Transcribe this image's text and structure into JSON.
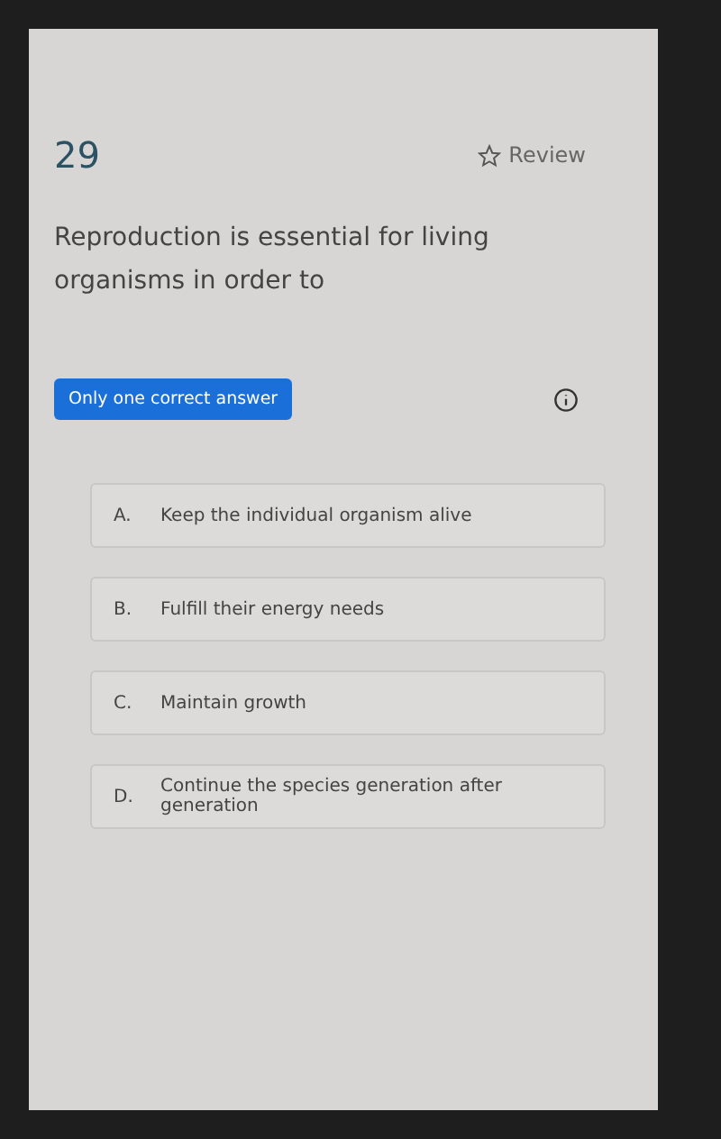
{
  "question": {
    "number": "29",
    "review": "Review",
    "text": "Reproduction is essential for living organisms in order to"
  },
  "answer_type": "Only one correct answer",
  "options": [
    {
      "letter": "A.",
      "text": "Keep the individual organism alive",
      "selected": false
    },
    {
      "letter": "B.",
      "text": "Fulfill their energy needs",
      "selected": false
    },
    {
      "letter": "C.",
      "text": "Maintain growth",
      "selected": false
    },
    {
      "letter": "D.",
      "text": "Continue the species generation after generation",
      "selected": false
    }
  ]
}
